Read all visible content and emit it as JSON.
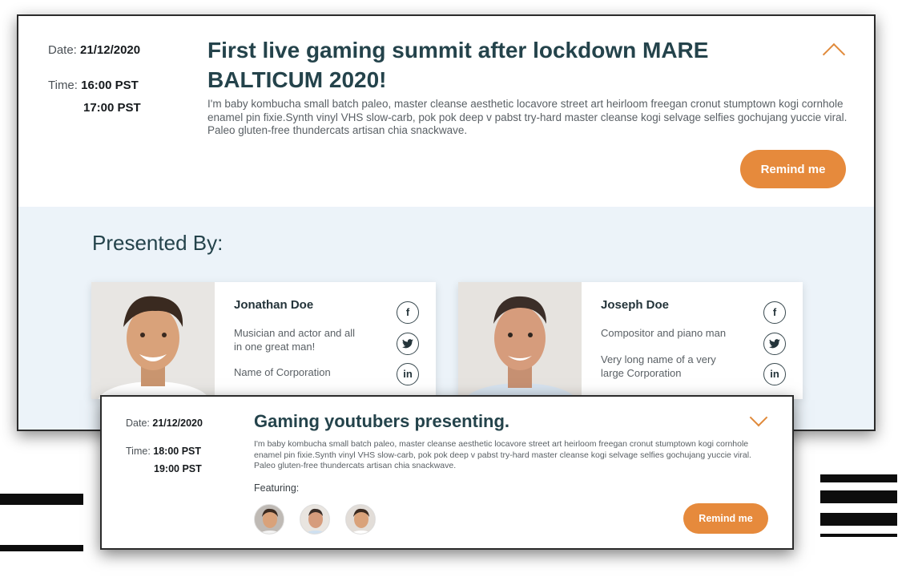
{
  "event1": {
    "date_label": "Date:",
    "date": "21/12/2020",
    "time_label": "Time:",
    "time_start": "16:00 PST",
    "time_end": "17:00 PST",
    "title": "First live gaming summit after lockdown MARE BALTICUM 2020!",
    "description": "I'm baby kombucha small batch paleo, master cleanse aesthetic locavore street art heirloom freegan cronut stumptown kogi cornhole enamel pin fixie.Synth vinyl VHS slow-carb, pok pok deep v pabst try-hard master cleanse kogi selvage selfies gochujang yuccie viral. Paleo gluten-free thundercats artisan chia snackwave.",
    "button": "Remind me",
    "presented_by": "Presented By:",
    "presenters": [
      {
        "name": "Jonathan Doe",
        "desc": "Musician and actor and all in one great man!",
        "corp": "Name of Corporation",
        "social": [
          "f",
          "t",
          "in"
        ]
      },
      {
        "name": "Joseph Doe",
        "desc": "Compositor and piano man",
        "corp": "Very long name of a very large Corporation",
        "social": [
          "f",
          "t",
          "in"
        ]
      }
    ]
  },
  "event2": {
    "date_label": "Date:",
    "date": "21/12/2020",
    "time_label": "Time:",
    "time_start": "18:00 PST",
    "time_end": "19:00 PST",
    "title": "Gaming youtubers presenting.",
    "description": "I'm baby kombucha small batch paleo, master cleanse aesthetic locavore street art heirloom freegan cronut stumptown kogi cornhole enamel pin fixie.Synth vinyl VHS slow-carb, pok pok deep v pabst try-hard master cleanse kogi selvage selfies gochujang yuccie viral. Paleo gluten-free thundercats artisan chia snackwave.",
    "featuring": "Featuring:",
    "button": "Remind me"
  },
  "icons": {
    "collapse": "chevron-up-icon",
    "expand": "chevron-down-icon",
    "facebook": "facebook-icon",
    "twitter": "twitter-icon",
    "linkedin": "linkedin-icon"
  },
  "colors": {
    "accent": "#e68a3c",
    "title": "#24434b",
    "panel": "#ecf3f9"
  }
}
